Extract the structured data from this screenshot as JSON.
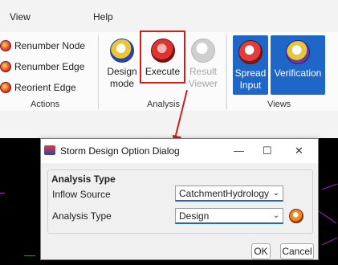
{
  "menubar": {
    "view": "View",
    "help": "Help"
  },
  "actions_group": {
    "items": [
      "Renumber Node",
      "Renumber Edge",
      "Reorient Edge"
    ],
    "label": "Actions"
  },
  "analysis_group": {
    "design_mode": "Design\nmode",
    "execute": "Execute",
    "result_viewer": "Result\nViewer",
    "label": "Analysis"
  },
  "views_group": {
    "spread_input": "Spread\nInput",
    "verification": "Verification",
    "label": "Views"
  },
  "dialog": {
    "title": "Storm Design Option Dialog",
    "controls": {
      "minimize": "—",
      "maximize": "☐",
      "close": "✕"
    },
    "section_title": "Analysis Type",
    "inflow_source_label": "Inflow Source",
    "inflow_source_value": "CatchmentHydrology",
    "analysis_type_label": "Analysis Type",
    "analysis_type_value": "Design",
    "ok": "OK",
    "cancel": "Cancel"
  },
  "colors": {
    "accent": "#1e67c8",
    "highlight": "#d01d1d",
    "cad_line": "#b01ad1"
  }
}
